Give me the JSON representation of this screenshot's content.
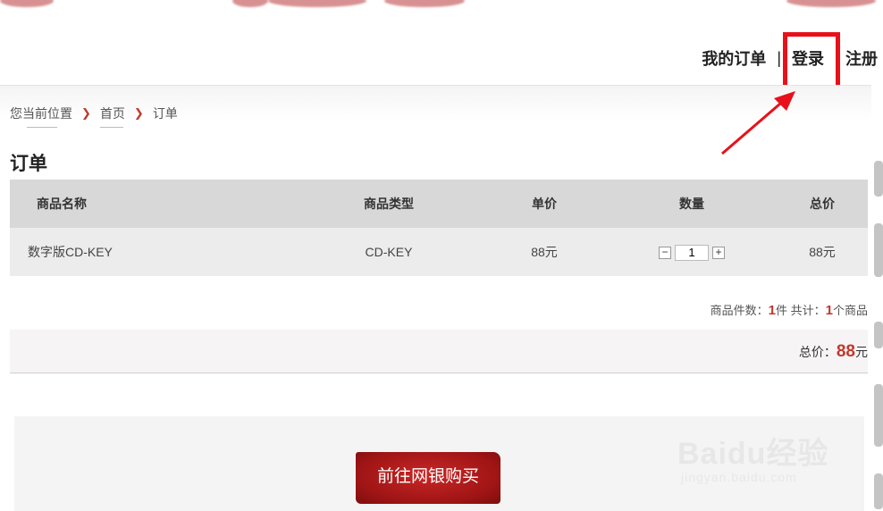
{
  "header": {
    "nav": {
      "my_orders": "我的订单",
      "separator": "|",
      "login": "登录",
      "register": "注册"
    }
  },
  "breadcrumb": {
    "label": "您当前位置",
    "home": "首页",
    "current": "订单"
  },
  "page_title": "订单",
  "table": {
    "headers": [
      "商品名称",
      "商品类型",
      "单价",
      "数量",
      "总价"
    ],
    "rows": [
      {
        "name": "数字版CD-KEY",
        "type": "CD-KEY",
        "unit_price": "88元",
        "quantity": "1",
        "total": "88元"
      }
    ]
  },
  "summary": {
    "count_label": "商品件数：",
    "count": "1",
    "count_unit": "件",
    "total_label": " 共计：",
    "total_count": "1",
    "total_unit": "个商品"
  },
  "total": {
    "label": "总价：",
    "amount": "88",
    "unit": "元"
  },
  "pay_button": "前往网银购买",
  "watermark": {
    "main": "Baidu经验",
    "sub": "jingyan.baidu.com"
  },
  "colors": {
    "accent": "#c0392b",
    "highlight": "#e8111a",
    "button": "#a91b1b"
  }
}
